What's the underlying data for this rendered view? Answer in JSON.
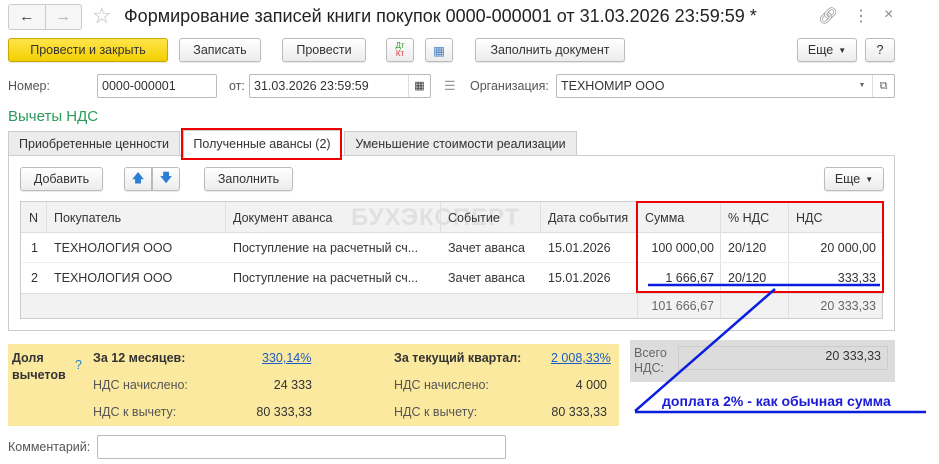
{
  "title": "Формирование записей книги покупок 0000-000001 от 31.03.2026 23:59:59 *",
  "toolbar": {
    "post_close": "Провести и закрыть",
    "save": "Записать",
    "post": "Провести",
    "dt": "Дт",
    "kt": "Кт",
    "fill_doc": "Заполнить документ",
    "more": "Еще",
    "help": "?"
  },
  "header": {
    "number_label": "Номер:",
    "number": "0000-000001",
    "date_label": "от:",
    "date": "31.03.2026 23:59:59",
    "org_label": "Организация:",
    "org": "ТЕХНОМИР ООО"
  },
  "section_title": "Вычеты НДС",
  "tabs": [
    "Приобретенные ценности",
    "Полученные авансы (2)",
    "Уменьшение стоимости реализации"
  ],
  "table_toolbar": {
    "add": "Добавить",
    "fill": "Заполнить",
    "more": "Еще"
  },
  "watermark": "БУХЭКСПЕРТ",
  "table": {
    "columns": [
      "N",
      "Покупатель",
      "Документ аванса",
      "Событие",
      "Дата события",
      "Сумма",
      "% НДС",
      "НДС"
    ],
    "rows": [
      [
        "1",
        "ТЕХНОЛОГИЯ ООО",
        "Поступление на расчетный сч...",
        "Зачет аванса",
        "15.01.2026",
        "100 000,00",
        "20/120",
        "20 000,00"
      ],
      [
        "2",
        "ТЕХНОЛОГИЯ ООО",
        "Поступление на расчетный сч...",
        "Зачет аванса",
        "15.01.2026",
        "1 666,67",
        "20/120",
        "333,33"
      ]
    ],
    "total_sum": "101 666,67",
    "total_vat": "20 333,33"
  },
  "share": {
    "label": "Доля вычетов",
    "help": "?",
    "m12_label": "За 12 месяцев:",
    "m12_value": "330,14%",
    "q_label": "За текущий квартал:",
    "q_value": "2 008,33%",
    "accrued_label": "НДС начислено:",
    "m12_accrued": "24 333",
    "q_accrued": "4 000",
    "deduct_label": "НДС к вычету:",
    "m12_deduct": "80 333,33",
    "q_deduct": "80 333,33"
  },
  "total": {
    "label": "Всего НДС:",
    "value": "20 333,33"
  },
  "annotation": "доплата 2% - как обычная сумма",
  "comment_label": "Комментарий:",
  "comment": ""
}
